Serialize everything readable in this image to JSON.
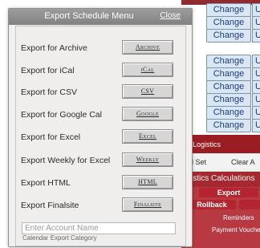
{
  "background": {
    "rows": [
      {
        "suffix": "es",
        "change": "Change",
        "chip": "U"
      },
      {
        "suffix": "es",
        "change": "Change",
        "chip": "U"
      },
      {
        "suffix": "es",
        "change": "Change",
        "chip": "U"
      },
      {
        "suffix": "es",
        "change": "Change",
        "chip": "U"
      },
      {
        "suffix": "es",
        "change": "Change",
        "chip": "U"
      },
      {
        "suffix": "es",
        "change": "Change",
        "chip": "U"
      },
      {
        "suffix": "es",
        "change": "Change",
        "chip": "U"
      },
      {
        "suffix": "es",
        "change": "Change",
        "chip": "U"
      },
      {
        "suffix": "es",
        "change": "Change",
        "chip": "U"
      }
    ],
    "logistics_label": "Logistics",
    "set_label": "d Set",
    "clear_label": "Clear A",
    "calculations_label": "istics Calculations",
    "export_label": "Export",
    "rollback_label": "Rollback",
    "reminders_label": "Reminders",
    "payment_label": "Payment Voucher"
  },
  "modal": {
    "title": "Export Schedule Menu",
    "close_label": "Close",
    "items": [
      {
        "label": "Export for Archive",
        "button": "Archive"
      },
      {
        "label": "Export for iCal",
        "button": "iCal"
      },
      {
        "label": "Export for CSV",
        "button": "CSV"
      },
      {
        "label": "Export for Google Cal",
        "button": "Google"
      },
      {
        "label": "Export for Excel",
        "button": "Excel"
      },
      {
        "label": "Export Weekly for Excel",
        "button": "Weekly"
      },
      {
        "label": "Export HTML",
        "button": "HTML"
      },
      {
        "label": "Export Finalsite",
        "button": "Finalsite"
      }
    ],
    "account_placeholder": "Enter Account Name",
    "account_value": "",
    "account_caption": "Calendar Export Category"
  }
}
